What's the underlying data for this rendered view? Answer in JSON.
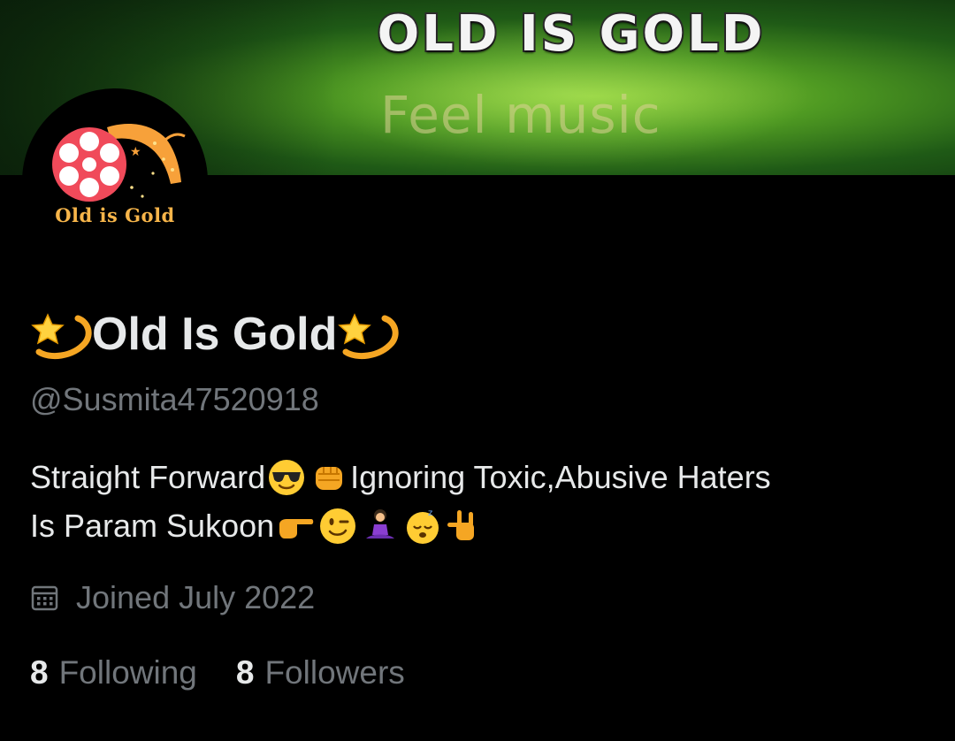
{
  "banner": {
    "title": "OLD IS GOLD",
    "subtitle": "Feel music"
  },
  "avatar": {
    "text": "Old is Gold",
    "colors": {
      "reel": "#f04a5a",
      "ribbon": "#f7a13a",
      "text": "#f7b54a"
    }
  },
  "profile": {
    "display_name": "Old Is Gold",
    "name_emoji": "dizzy-star-emoji",
    "handle": "@Susmita47520918",
    "bio_line1_text_a": "Straight Forward",
    "bio_line1_text_b": "Ignoring Toxic,Abusive Haters",
    "bio_line2_text": "Is Param Sukoon",
    "bio_emojis": [
      "sunglasses-face",
      "oncoming-fist",
      "backhand-pointing-right",
      "winking-face",
      "woman-in-lotus-position",
      "sleeping-face",
      "love-you-gesture"
    ],
    "joined": "Joined July 2022"
  },
  "stats": {
    "following_count": "8",
    "following_label": "Following",
    "followers_count": "8",
    "followers_label": "Followers"
  },
  "colors": {
    "background": "#000000",
    "primary_text": "#e7e9ea",
    "secondary_text": "#71767b"
  }
}
